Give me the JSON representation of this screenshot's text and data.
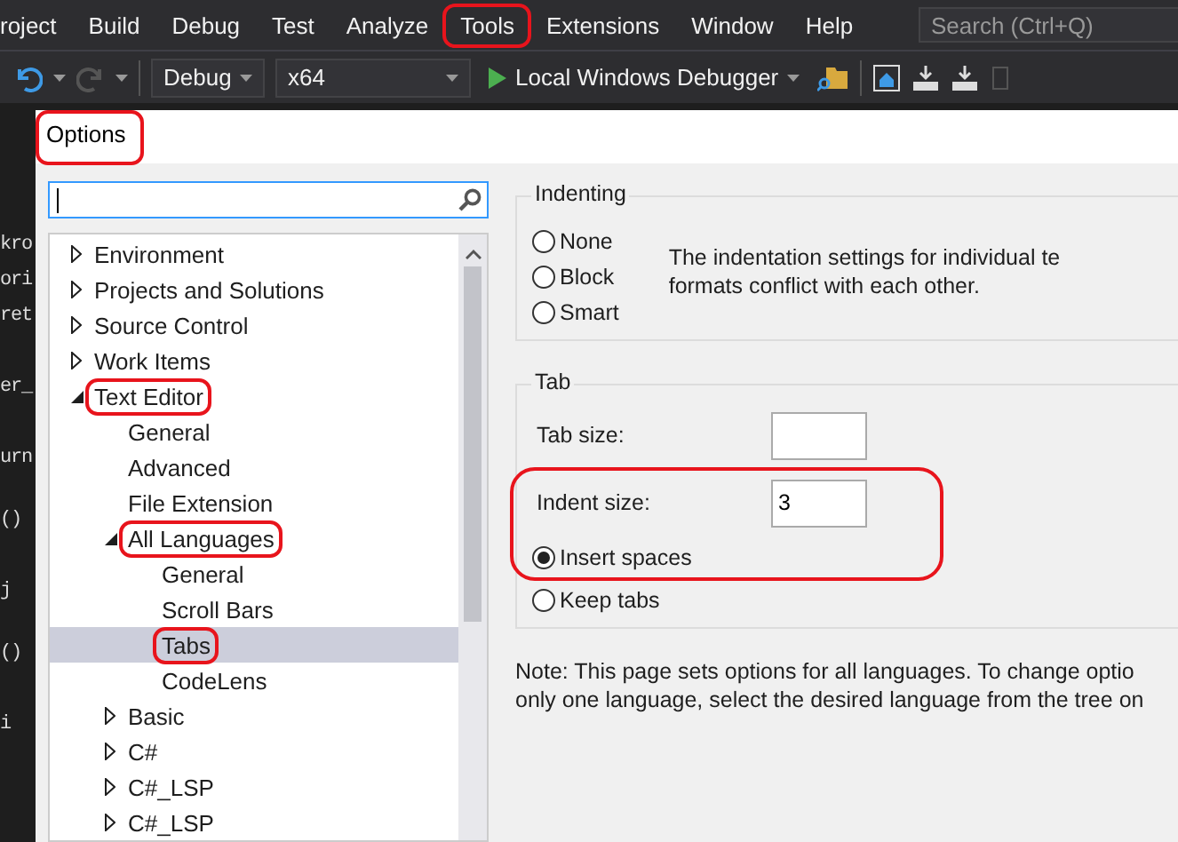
{
  "menu_bar": {
    "items": [
      {
        "label": "roject",
        "annotated": false
      },
      {
        "label": "Build",
        "annotated": false
      },
      {
        "label": "Debug",
        "annotated": false
      },
      {
        "label": "Test",
        "annotated": false
      },
      {
        "label": "Analyze",
        "annotated": false
      },
      {
        "label": "Tools",
        "annotated": true
      },
      {
        "label": "Extensions",
        "annotated": false
      },
      {
        "label": "Window",
        "annotated": false
      },
      {
        "label": "Help",
        "annotated": false
      }
    ],
    "search": {
      "placeholder": "Search (Ctrl+Q)"
    }
  },
  "toolbar": {
    "redo_disabled": true,
    "configuration": "Debug",
    "platform": "x64",
    "debugger": "Local Windows Debugger"
  },
  "editor": {
    "code_fragments": [
      "kro",
      "ori",
      "ret",
      "er_",
      "urn",
      "()",
      "j",
      "()",
      "i"
    ]
  },
  "dialog": {
    "title": "Options",
    "title_annotated": true,
    "tree": [
      {
        "label": "Environment",
        "kind": "folder",
        "expanded": false,
        "selected": false,
        "annotated": false
      },
      {
        "label": "Projects and Solutions",
        "kind": "folder",
        "expanded": false,
        "selected": false,
        "annotated": false
      },
      {
        "label": "Source Control",
        "kind": "folder",
        "expanded": false,
        "selected": false,
        "annotated": false
      },
      {
        "label": "Work Items",
        "kind": "folder",
        "expanded": false,
        "selected": false,
        "annotated": false
      },
      {
        "label": "Text Editor",
        "kind": "folder",
        "expanded": true,
        "selected": false,
        "annotated": true,
        "children": [
          {
            "label": "General",
            "kind": "leaf",
            "selected": false,
            "annotated": false
          },
          {
            "label": "Advanced",
            "kind": "leaf",
            "selected": false,
            "annotated": false
          },
          {
            "label": "File Extension",
            "kind": "leaf",
            "selected": false,
            "annotated": false
          },
          {
            "label": "All Languages",
            "kind": "folder",
            "expanded": true,
            "selected": false,
            "annotated": true,
            "children": [
              {
                "label": "General",
                "kind": "leaf",
                "selected": false,
                "annotated": false
              },
              {
                "label": "Scroll Bars",
                "kind": "leaf",
                "selected": false,
                "annotated": false
              },
              {
                "label": "Tabs",
                "kind": "leaf",
                "selected": true,
                "annotated": true
              },
              {
                "label": "CodeLens",
                "kind": "leaf",
                "selected": false,
                "annotated": false
              }
            ]
          },
          {
            "label": "Basic",
            "kind": "folder",
            "expanded": false,
            "selected": false,
            "annotated": false
          },
          {
            "label": "C#",
            "kind": "folder",
            "expanded": false,
            "selected": false,
            "annotated": false
          },
          {
            "label": "C#_LSP",
            "kind": "folder",
            "expanded": false,
            "selected": false,
            "annotated": false
          },
          {
            "label": "C#_LSP",
            "kind": "folder",
            "expanded": false,
            "selected": false,
            "annotated": false
          }
        ]
      }
    ],
    "indenting": {
      "title": "Indenting",
      "options": [
        {
          "label": "None",
          "selected": false
        },
        {
          "label": "Block",
          "selected": false
        },
        {
          "label": "Smart",
          "selected": false
        }
      ],
      "description_lines": [
        "The indentation settings for individual te",
        "formats conflict with each other."
      ]
    },
    "tab": {
      "title": "Tab",
      "tab_size_label": "Tab size:",
      "indent_size_label": "Indent size:",
      "indent_size_value": "3",
      "annotated": true,
      "options": [
        {
          "label": "Insert spaces",
          "selected": true
        },
        {
          "label": "Keep tabs",
          "selected": false
        }
      ]
    },
    "note_lines": [
      "Note: This page sets options for all languages. To change optio",
      "only one language, select the desired language from the tree on"
    ]
  }
}
